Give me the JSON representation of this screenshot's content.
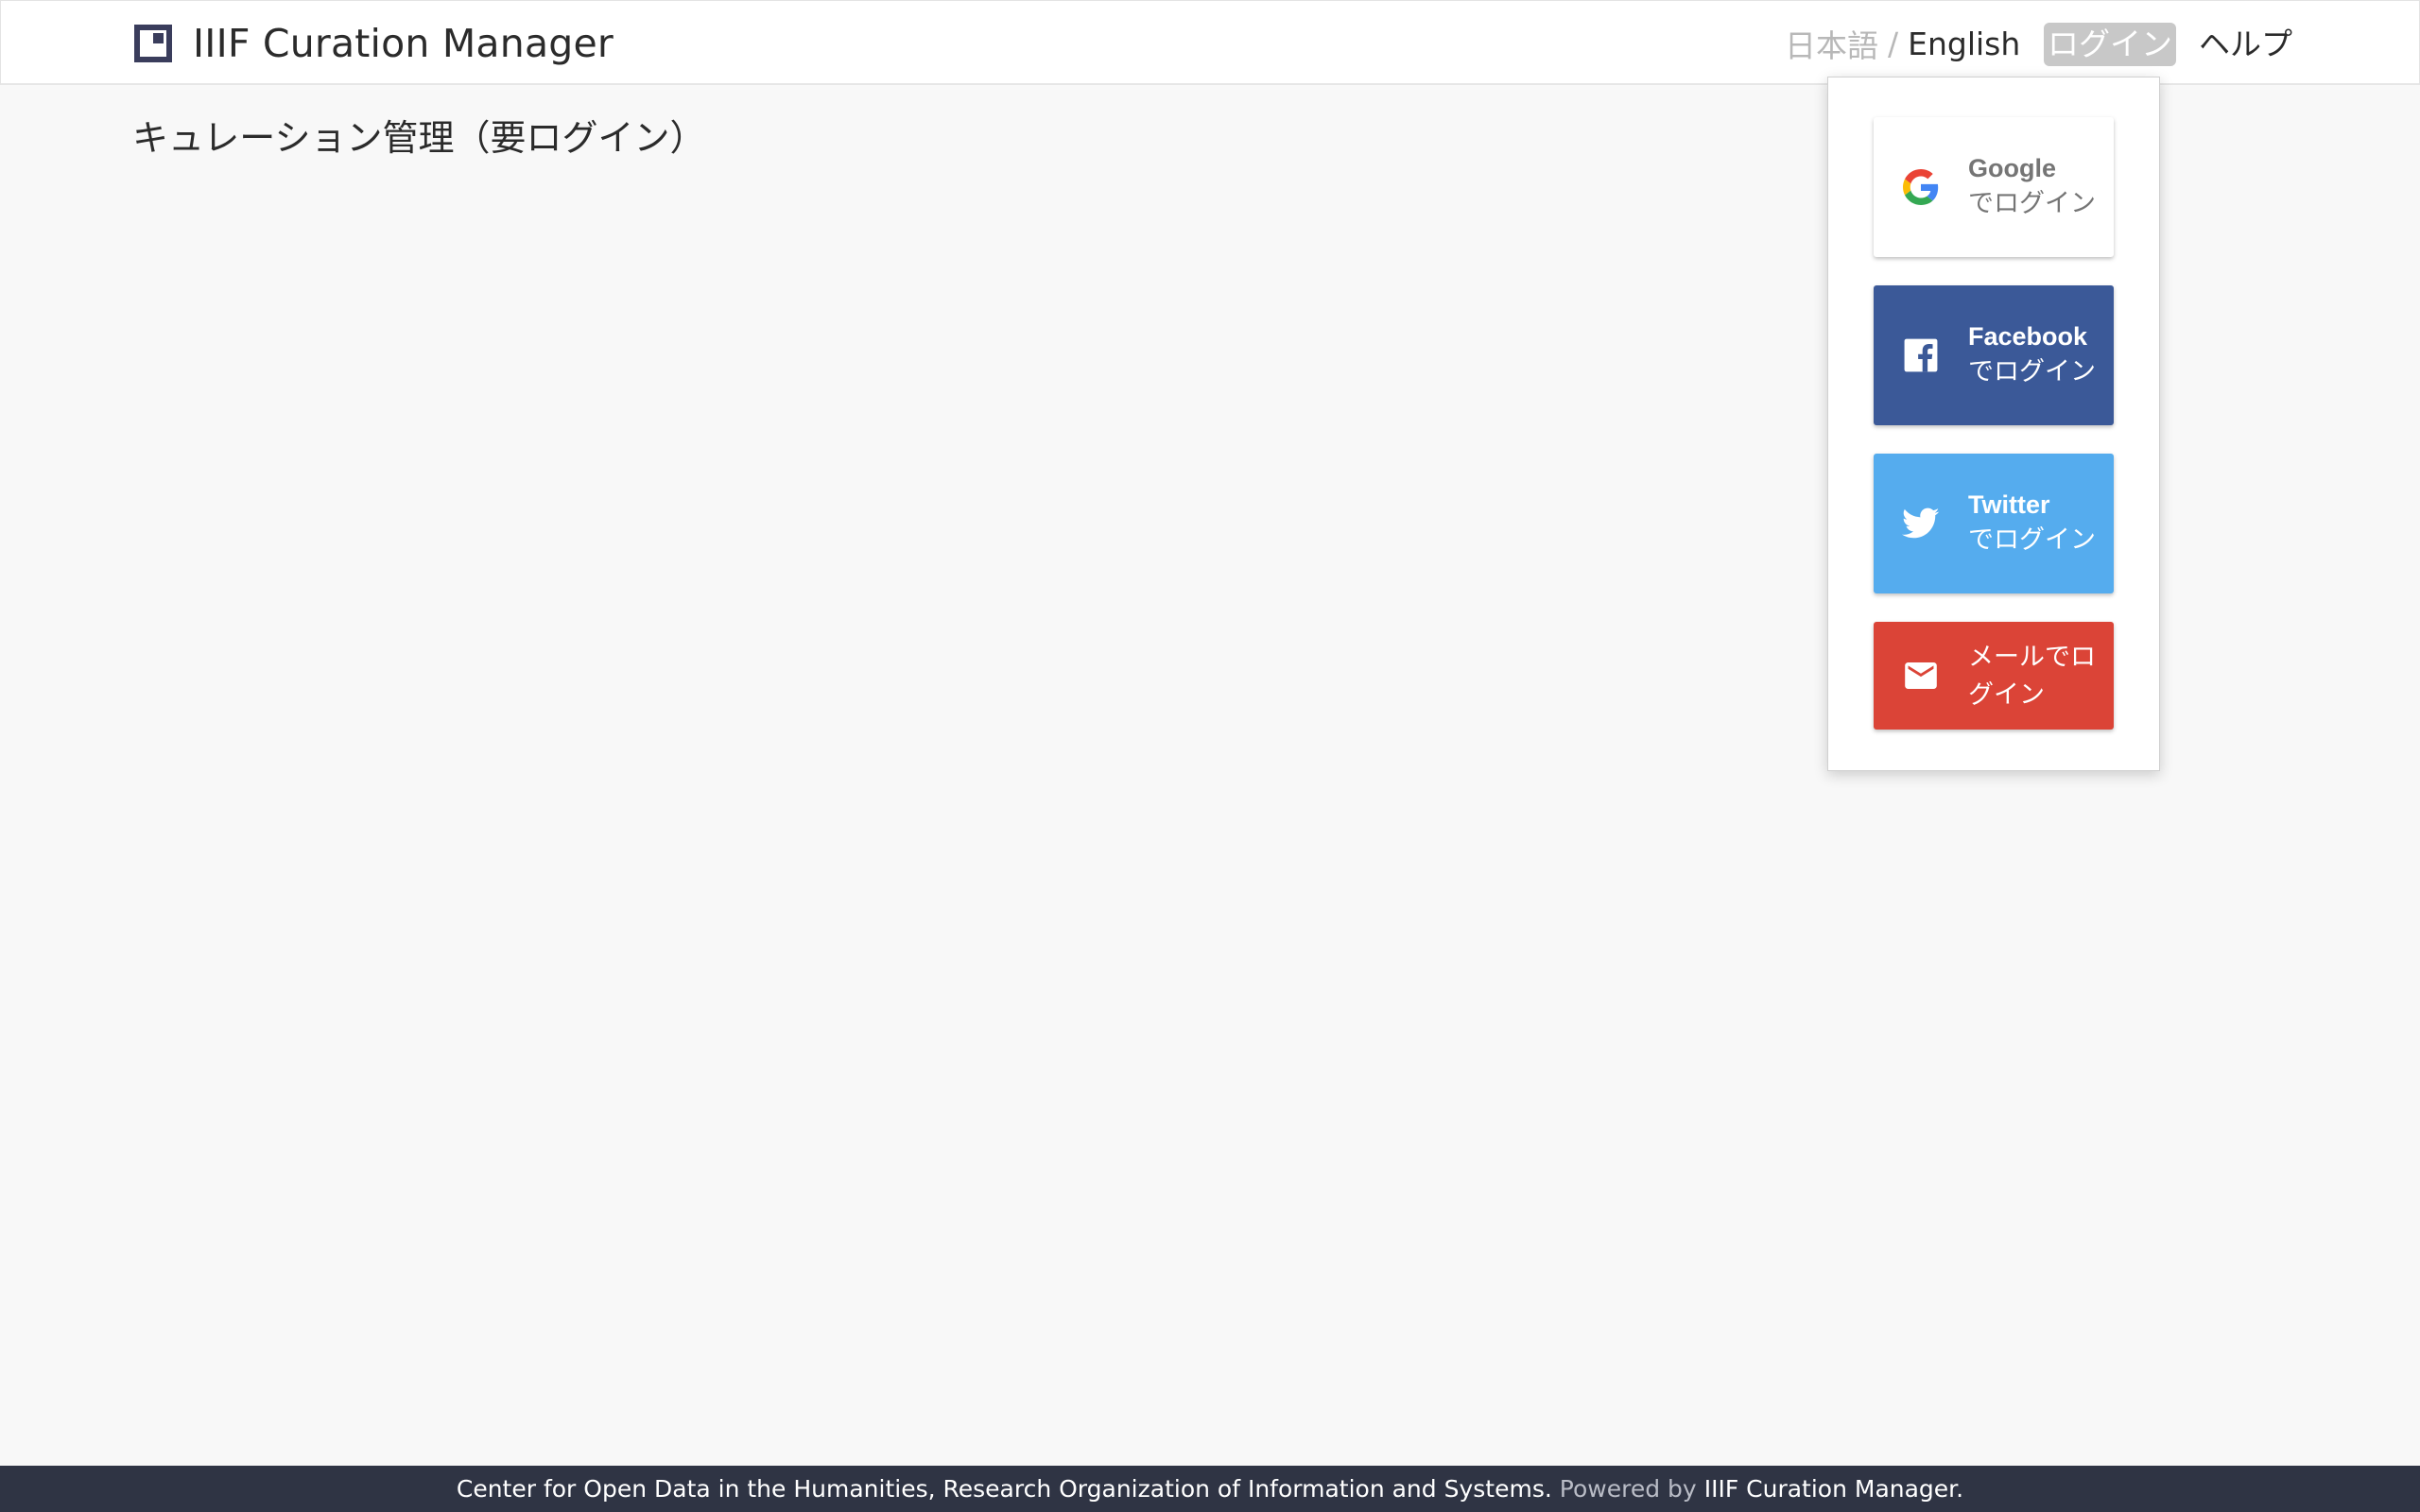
{
  "header": {
    "title": "IIIF Curation Manager",
    "lang_ja": "日本語",
    "lang_separator": "/",
    "lang_en": "English",
    "login_label": "ログイン",
    "help_label": "ヘルプ"
  },
  "main": {
    "page_title": "キュレーション管理（要ログイン）"
  },
  "login_menu": {
    "google": {
      "provider": "Google",
      "suffix": "でログイン",
      "icon": "google-icon"
    },
    "facebook": {
      "provider": "Facebook",
      "suffix": "でログイン",
      "icon": "facebook-icon"
    },
    "twitter": {
      "provider": "Twitter",
      "suffix": "でログイン",
      "icon": "twitter-icon"
    },
    "email": {
      "label": "メールでログイン",
      "icon": "mail-icon"
    }
  },
  "footer": {
    "org": "Center for Open Data in the Humanities, Research Organization of Information and Systems.",
    "powered_by": "Powered by",
    "powered_name": "IIIF Curation Manager."
  },
  "colors": {
    "header_bg": "#ffffff",
    "page_bg": "#f8f8f8",
    "footer_bg": "#2f3444",
    "google": "#ffffff",
    "facebook": "#3b5998",
    "twitter": "#55acee",
    "email": "#db4437"
  }
}
